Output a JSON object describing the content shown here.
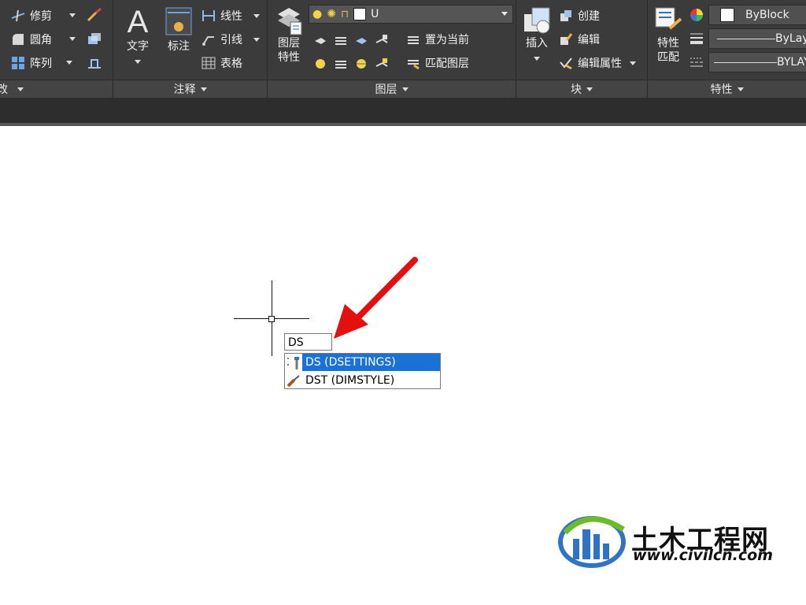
{
  "ribbon": {
    "modify": {
      "trim": "修剪",
      "fillet": "圆角",
      "array": "阵列",
      "footer_partial": "改"
    },
    "annotation": {
      "text": "文字",
      "dimension": "标注",
      "linear": "线性",
      "leader": "引线",
      "table": "表格",
      "footer": "注释"
    },
    "layers": {
      "properties_line1": "图层",
      "properties_line2": "特性",
      "current_layer": "U",
      "set_current": "置为当前",
      "match_layer": "匹配图层",
      "footer": "图层"
    },
    "block": {
      "insert": "插入",
      "create": "创建",
      "edit": "编辑",
      "edit_attributes": "编辑属性",
      "footer": "块"
    },
    "properties": {
      "match_line1": "特性",
      "match_line2": "匹配",
      "color": "ByBlock",
      "lineweight": "ByLay",
      "linetype": "BYLAY",
      "footer": "特性"
    }
  },
  "canvas": {
    "command_input": "DS",
    "suggestions": [
      {
        "label": "DS (DSETTINGS)",
        "icon": "drafting-settings-icon",
        "selected": true
      },
      {
        "label": "DST (DIMSTYLE)",
        "icon": "brush-icon",
        "selected": false
      }
    ]
  },
  "watermark": {
    "name": "土木工程网",
    "url": "www.civilcn.com"
  },
  "colors": {
    "ribbon_bg": "#3b3b3b",
    "selection": "#1a72d6",
    "annotation_arrow": "#e31010"
  }
}
